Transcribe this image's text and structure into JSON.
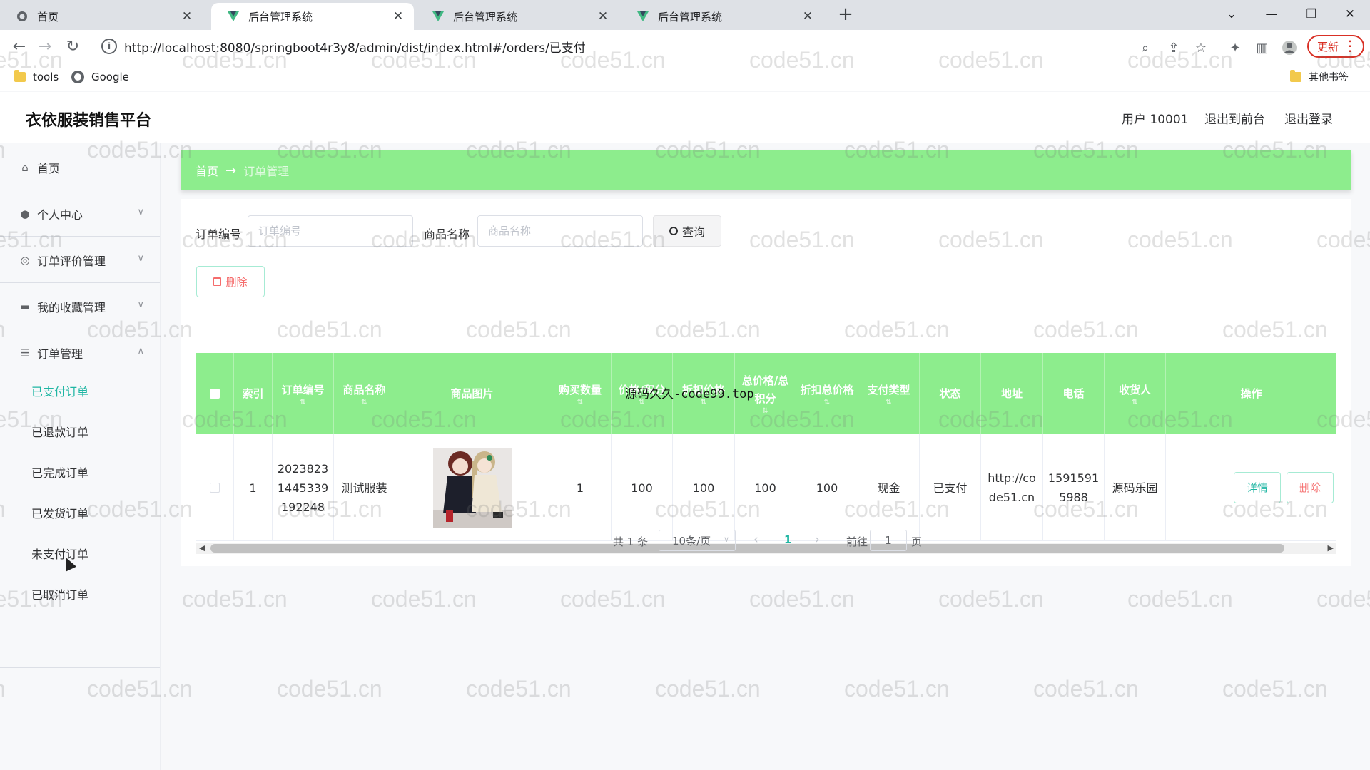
{
  "browser": {
    "tabs": [
      {
        "title": "首页",
        "icon": "globe-icon",
        "active": false
      },
      {
        "title": "后台管理系统",
        "icon": "vue-logo-icon",
        "active": true
      },
      {
        "title": "后台管理系统",
        "icon": "vue-logo-icon",
        "active": false
      },
      {
        "title": "后台管理系统",
        "icon": "vue-logo-icon",
        "active": false
      }
    ],
    "url": "http://localhost:8080/springboot4r3y8/admin/dist/index.html#/orders/已支付",
    "update_label": "更新",
    "bookmarks": [
      {
        "label": "tools",
        "icon": "folder-icon"
      },
      {
        "label": "Google",
        "icon": "globe-icon"
      }
    ],
    "other_bookmarks": "其他书签"
  },
  "app": {
    "title": "衣依服装销售平台",
    "user_label": "用户 10001",
    "to_front_label": "退出到前台",
    "logout_label": "退出登录"
  },
  "sidebar": {
    "items": [
      {
        "label": "首页",
        "icon": "home-icon"
      },
      {
        "label": "个人中心",
        "icon": "user-icon"
      },
      {
        "label": "订单评价管理",
        "icon": "circle-icon"
      },
      {
        "label": "我的收藏管理",
        "icon": "monitor-icon"
      },
      {
        "label": "订单管理",
        "icon": "sliders-icon"
      }
    ],
    "sub_items": [
      "已支付订单",
      "已退款订单",
      "已完成订单",
      "已发货订单",
      "未支付订单",
      "已取消订单"
    ],
    "active_sub": "已支付订单"
  },
  "breadcrumb": {
    "home": "首页",
    "separator": "→",
    "current": "订单管理"
  },
  "search": {
    "order_no_label": "订单编号",
    "order_no_placeholder": "订单编号",
    "product_name_label": "商品名称",
    "product_name_placeholder": "商品名称",
    "query_label": "查询"
  },
  "actions": {
    "delete_label": "删除"
  },
  "table": {
    "columns": [
      "索引",
      "订单编号",
      "商品名称",
      "商品图片",
      "购买数量",
      "价格/积分",
      "折扣价格",
      "总价格/总积分",
      "折扣总价格",
      "支付类型",
      "状态",
      "地址",
      "电话",
      "收货人",
      "操作"
    ],
    "rows": [
      {
        "index": "1",
        "order_no": "20238231445339192248",
        "product_name": "测试服装",
        "image": "product-photo",
        "quantity": "1",
        "price": "100",
        "discount_price": "100",
        "total": "100",
        "discount_total": "100",
        "pay_type": "现金",
        "status": "已支付",
        "address": "http://code51.cn",
        "phone": "15915915988",
        "receiver": "源码乐园",
        "detail_label": "详情",
        "delete_label": "删除"
      }
    ]
  },
  "pagination": {
    "total": "共 1 条",
    "page_size": "10条/页",
    "current_page": "1",
    "goto_label": "前往",
    "goto_value": "1",
    "page_suffix": "页"
  },
  "overlay": "源码久久-code99.top",
  "watermark": "code51.cn",
  "colors": {
    "header_green": "#8ded8d",
    "accent_teal": "#1fb6a3",
    "danger": "#f56c6c"
  }
}
